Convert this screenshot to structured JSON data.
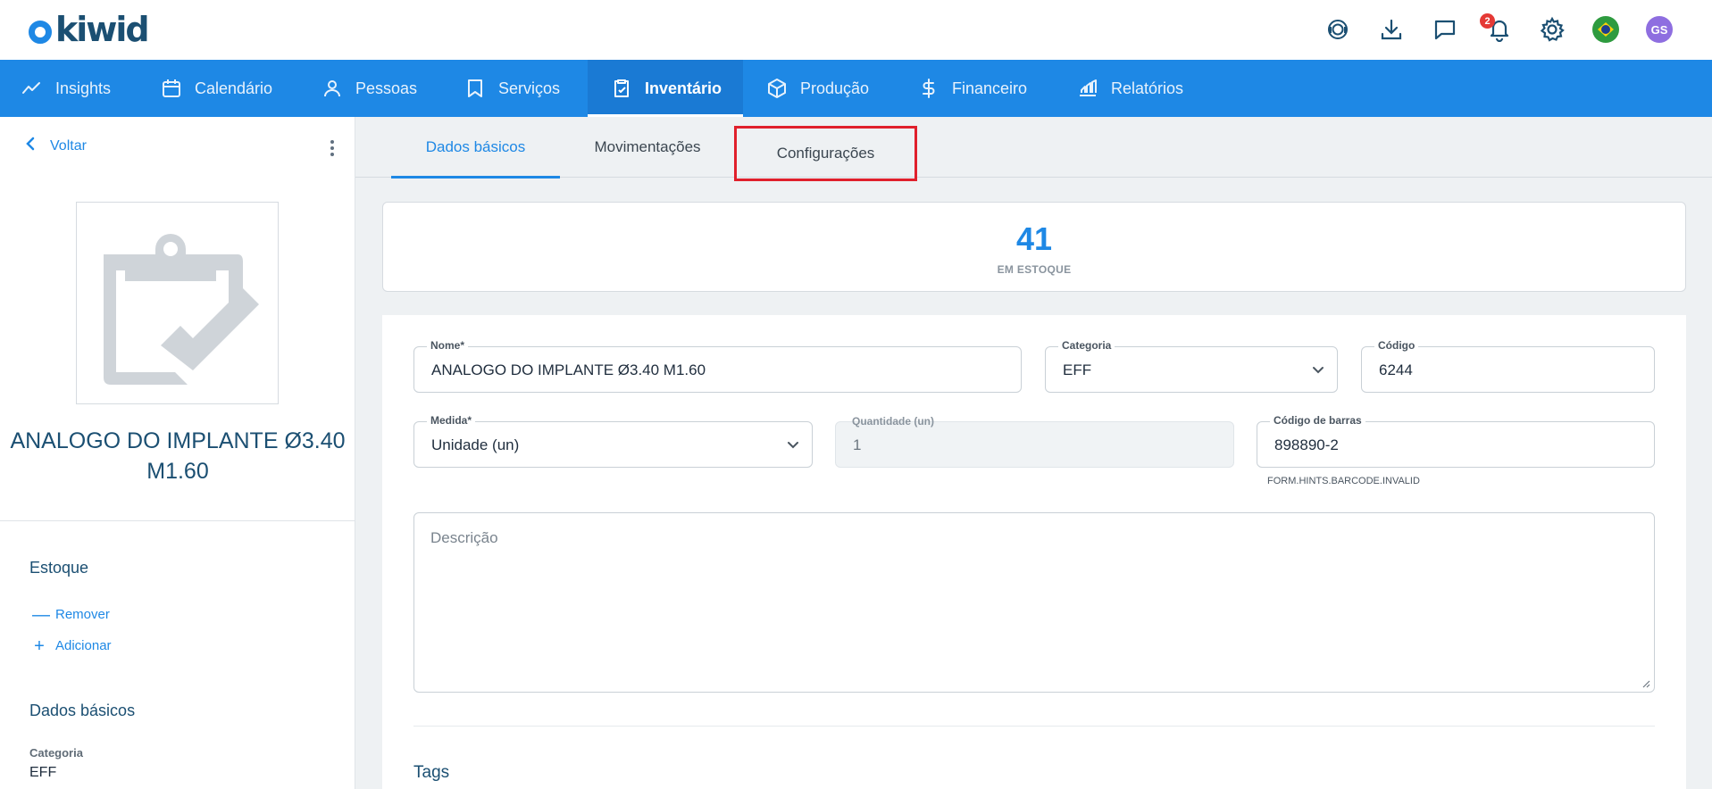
{
  "brand": {
    "name": "kiwid"
  },
  "header": {
    "notifications_count": "2",
    "avatar_initials": "GS",
    "icons": [
      "support-icon",
      "download-icon",
      "chat-icon",
      "bell-icon",
      "gear-icon",
      "brazil-flag-icon",
      "avatar"
    ]
  },
  "nav": {
    "items": [
      {
        "label": "Insights",
        "icon": "trend-icon"
      },
      {
        "label": "Calendário",
        "icon": "calendar-icon"
      },
      {
        "label": "Pessoas",
        "icon": "person-icon"
      },
      {
        "label": "Serviços",
        "icon": "tooth-icon"
      },
      {
        "label": "Inventário",
        "icon": "clipboard-check-icon",
        "active": true
      },
      {
        "label": "Produção",
        "icon": "box-icon"
      },
      {
        "label": "Financeiro",
        "icon": "dollar-icon"
      },
      {
        "label": "Relatórios",
        "icon": "chart-icon"
      }
    ],
    "active_color": "#1a7ad4",
    "bar_color": "#1e88e5"
  },
  "sidebar": {
    "back_label": "Voltar",
    "product_name": "ANALOGO DO IMPLANTE Ø3.40 M1.60",
    "stock_section": "Estoque",
    "remove_label": "Remover",
    "add_label": "Adicionar",
    "basic_section": "Dados básicos",
    "category_label": "Categoria",
    "category_value": "EFF"
  },
  "tabs": {
    "items": [
      "Dados básicos",
      "Movimentações",
      "Configurações"
    ],
    "active": "Dados básicos",
    "highlighted": "Configurações"
  },
  "stock": {
    "value": "41",
    "label": "EM ESTOQUE"
  },
  "form": {
    "name": {
      "label": "Nome*",
      "value": "ANALOGO DO IMPLANTE Ø3.40 M1.60"
    },
    "category": {
      "label": "Categoria",
      "value": "EFF"
    },
    "code": {
      "label": "Código",
      "value": "6244"
    },
    "unit": {
      "label": "Medida*",
      "value": "Unidade (un)"
    },
    "quantity": {
      "label": "Quantidade (un)",
      "value": "1"
    },
    "barcode": {
      "label": "Código de barras",
      "value": "898890-2",
      "hint": "FORM.HINTS.BARCODE.INVALID"
    },
    "description": {
      "placeholder": "Descrição"
    },
    "tags_title": "Tags"
  },
  "colors": {
    "accent": "#1e88e5",
    "title": "#1b4f72",
    "highlight_border": "#e0202c",
    "badge": "#e53935"
  }
}
